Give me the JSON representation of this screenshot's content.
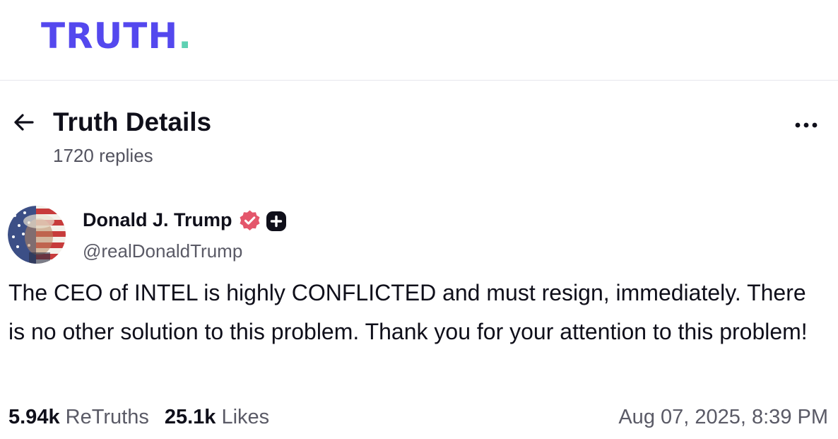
{
  "brand": {
    "logo_text": "TRUTH",
    "logo_dot": ".",
    "primary_color": "#5448ee",
    "dot_color": "#5ed1b3"
  },
  "header": {
    "back_icon": "arrow-left-icon",
    "title": "Truth Details",
    "subtitle": "1720 replies",
    "more_icon": "more-horizontal-icon"
  },
  "post": {
    "author": {
      "name": "Donald J. Trump",
      "handle": "@realDonaldTrump",
      "verified_icon": "verified-badge-icon",
      "verified_color": "#e4566b",
      "plus_icon": "plus-badge-icon"
    },
    "text": "The CEO of INTEL is highly CONFLICTED and must resign, immediately. There is no other solution to this problem. Thank you for your attention to this problem!",
    "stats": {
      "retruths_count": "5.94k",
      "retruths_label": "ReTruths",
      "likes_count": "25.1k",
      "likes_label": "Likes"
    },
    "timestamp": "Aug 07, 2025, 8:39 PM"
  }
}
